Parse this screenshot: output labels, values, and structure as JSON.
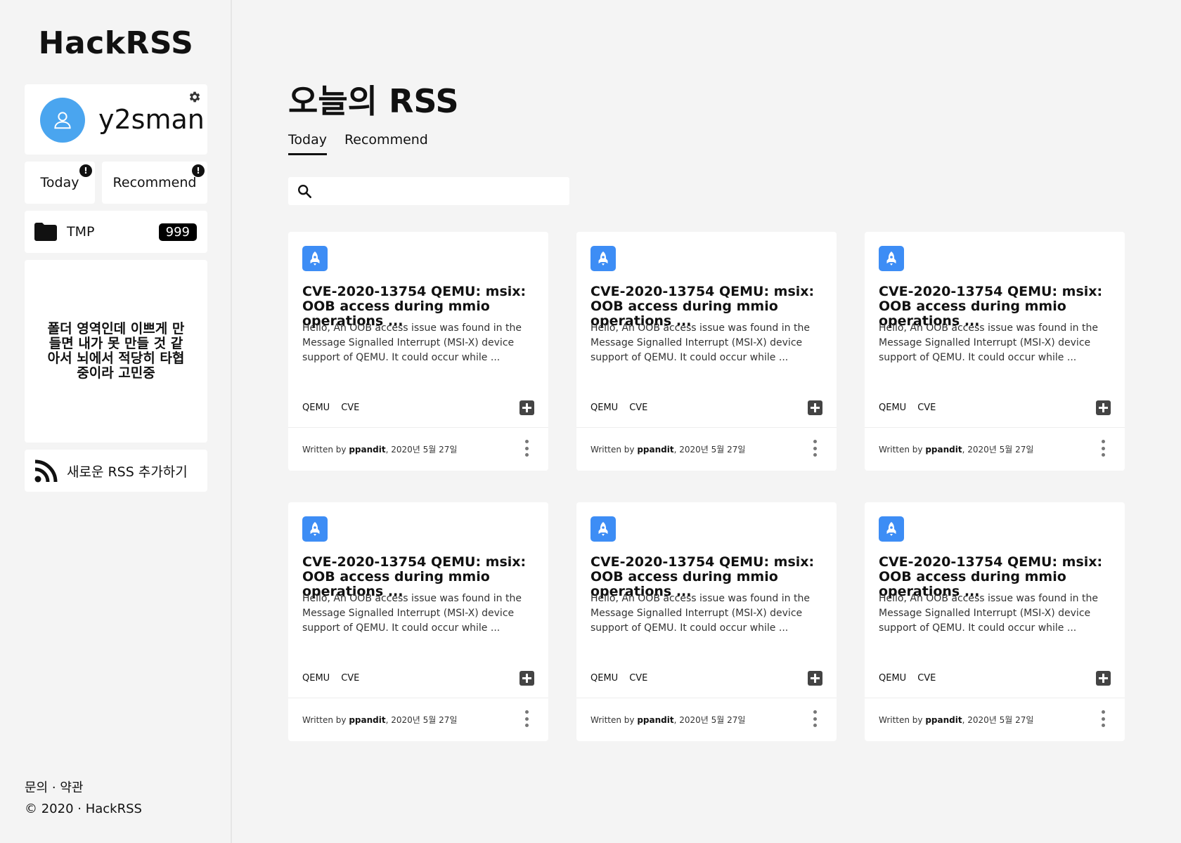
{
  "sidebar": {
    "logo": "HackRSS",
    "profile": {
      "username": "y2sman"
    },
    "nav": {
      "today": "Today",
      "recommend": "Recommend",
      "alert": "!"
    },
    "folder": {
      "name": "TMP",
      "count": "999"
    },
    "folder_area_text": "폴더 영역인데 이쁘게 만들면 내가 못 만들 것 같아서 뇌에서 적당히 타협중이라 고민중",
    "add_rss": "새로운 RSS 추가하기",
    "footer": {
      "contact": "문의",
      "sep": "·",
      "terms": "약관",
      "copyright": "© 2020 · HackRSS"
    }
  },
  "main": {
    "title": "오늘의 RSS",
    "tabs": [
      "Today",
      "Recommend"
    ],
    "search": {
      "placeholder": ""
    },
    "cards": [
      {
        "title": "CVE-2020-13754 QEMU: msix: OOB access during mmio operations ...",
        "description": "Hello, An OOB access issue was found in the Message Signalled Interrupt (MSI-X) device support of QEMU. It could occur while ...",
        "tags": [
          "QEMU",
          "CVE"
        ],
        "written_by": "Written by ",
        "author": "ppandit",
        "date": ", 2020년 5월 27일"
      },
      {
        "title": "CVE-2020-13754 QEMU: msix: OOB access during mmio operations ...",
        "description": "Hello, An OOB access issue was found in the Message Signalled Interrupt (MSI-X) device support of QEMU. It could occur while ...",
        "tags": [
          "QEMU",
          "CVE"
        ],
        "written_by": "Written by ",
        "author": "ppandit",
        "date": ", 2020년 5월 27일"
      },
      {
        "title": "CVE-2020-13754 QEMU: msix: OOB access during mmio operations ...",
        "description": "Hello, An OOB access issue was found in the Message Signalled Interrupt (MSI-X) device support of QEMU. It could occur while ...",
        "tags": [
          "QEMU",
          "CVE"
        ],
        "written_by": "Written by ",
        "author": "ppandit",
        "date": ", 2020년 5월 27일"
      },
      {
        "title": "CVE-2020-13754 QEMU: msix: OOB access during mmio operations ...",
        "description": "Hello, An OOB access issue was found in the Message Signalled Interrupt (MSI-X) device support of QEMU. It could occur while ...",
        "tags": [
          "QEMU",
          "CVE"
        ],
        "written_by": "Written by ",
        "author": "ppandit",
        "date": ", 2020년 5월 27일"
      },
      {
        "title": "CVE-2020-13754 QEMU: msix: OOB access during mmio operations ...",
        "description": "Hello, An OOB access issue was found in the Message Signalled Interrupt (MSI-X) device support of QEMU. It could occur while ...",
        "tags": [
          "QEMU",
          "CVE"
        ],
        "written_by": "Written by ",
        "author": "ppandit",
        "date": ", 2020년 5월 27일"
      },
      {
        "title": "CVE-2020-13754 QEMU: msix: OOB access during mmio operations ...",
        "description": "Hello, An OOB access issue was found in the Message Signalled Interrupt (MSI-X) device support of QEMU. It could occur while ...",
        "tags": [
          "QEMU",
          "CVE"
        ],
        "written_by": "Written by ",
        "author": "ppandit",
        "date": ", 2020년 5월 27일"
      }
    ]
  },
  "icons": {
    "avatar": "user-icon",
    "settings": "gear-icon",
    "folder": "folder-icon",
    "rss": "rss-icon",
    "search": "search-icon",
    "card": "rocket-icon",
    "add": "plus-icon",
    "more": "more-vertical-icon"
  },
  "colors": {
    "accent_blue": "#3d8df5",
    "avatar_blue": "#4aa5ef",
    "background": "#f4f4f4"
  }
}
